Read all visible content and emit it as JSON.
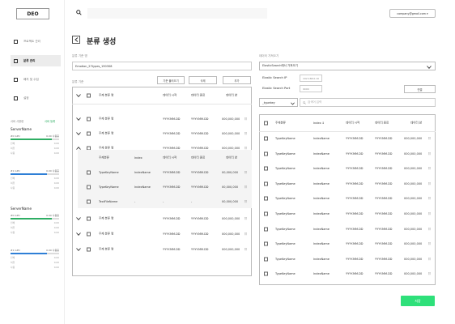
{
  "logo": "DEO",
  "nav": [
    {
      "label": "프로젝트 관리",
      "active": false
    },
    {
      "label": "분류 관리",
      "active": true
    },
    {
      "label": "배치 및 수집",
      "active": false
    },
    {
      "label": "설정",
      "active": false
    }
  ],
  "server_section": {
    "label": "서버 사용량",
    "link": "서버 등록"
  },
  "servers": [
    {
      "name": "ServerName",
      "metrics": [
        {
          "name": "#0 GPU",
          "value": "0.00 사용중",
          "fill": 0.85,
          "color": "#2fae64",
          "rows": [
            [
              "전체",
              "0.00"
            ],
            [
              "여유",
              "0.00"
            ],
            [
              "사용",
              "0.00"
            ]
          ]
        },
        {
          "name": "#1 GPU",
          "value": "0.00 사용중",
          "fill": 0.75,
          "color": "#2f7fd6",
          "rows": [
            [
              "전체",
              "0.00"
            ],
            [
              "여유",
              "0.00"
            ],
            [
              "사용",
              "0.00"
            ]
          ]
        }
      ]
    },
    {
      "name": "ServerName",
      "metrics": [
        {
          "name": "#0 GPU",
          "value": "0.00 사용중",
          "fill": 0.85,
          "color": "#2fae64",
          "rows": [
            [
              "전체",
              "0.00"
            ],
            [
              "여유",
              "0.00"
            ],
            [
              "사용",
              "0.00"
            ]
          ]
        },
        {
          "name": "#1 GPU",
          "value": "0.00 사용중",
          "fill": 0.75,
          "color": "#2f7fd6",
          "rows": [
            [
              "전체",
              "0.00"
            ],
            [
              "여유",
              "0.00"
            ],
            [
              "사용",
              "0.00"
            ]
          ]
        }
      ]
    }
  ],
  "header": {
    "account": "company@gmail.com ▾"
  },
  "page": {
    "title": "분류 생성"
  },
  "left": {
    "name_label": "분류 기준 명",
    "name_value": "Emotion_27types_190308",
    "criteria_label": "분류 기준",
    "buttons": [
      "기준 불러오기",
      "삭제",
      "추가"
    ],
    "columns": [
      "주제 분류 명",
      "데이터 시작",
      "데이터 종료",
      "데이터 양"
    ],
    "sub_columns": [
      "주제분류",
      "Index",
      "데이터 시작",
      "데이터 종료",
      "데이터 양"
    ],
    "rows": [
      {
        "label": "주제 분류 명",
        "start": "YYYY.MM.DD",
        "end": "YYYY.MM.DD",
        "amount": "000,000,000"
      },
      {
        "label": "주제 분류 명",
        "start": "YYYY.MM.DD",
        "end": "YYYY.MM.DD",
        "amount": "000,000,000"
      },
      {
        "label": "주제 분류 명",
        "start": "YYYY.MM.DD",
        "end": "YYYY.MM.DD",
        "amount": "000,000,000"
      }
    ],
    "sub_rows": [
      {
        "type": "TypeKeyName",
        "index": "IndexName",
        "start": "YYYY.MM.DD",
        "end": "YYYY.MM.DD",
        "amount": "00,000,000"
      },
      {
        "type": "TypeKeyName",
        "index": "IndexName",
        "start": "YYYY.MM.DD",
        "end": "YYYY.MM.DD",
        "amount": "00,000,000"
      },
      {
        "type": "TextFileName",
        "index": "-",
        "start": "-",
        "end": "-",
        "amount": "00,000,000"
      }
    ],
    "rows_after": [
      {
        "label": "주제 분류 명",
        "start": "YYYY.MM.DD",
        "end": "YYYY.MM.DD",
        "amount": "000,000,000"
      },
      {
        "label": "주제 분류 명",
        "start": "YYYY.MM.DD",
        "end": "YYYY.MM.DD",
        "amount": "000,000,000"
      },
      {
        "label": "주제 분류 명",
        "start": "YYYY.MM.DD",
        "end": "YYYY.MM.DD",
        "amount": "000,000,000"
      }
    ]
  },
  "right": {
    "section_label": "데이터 가져오기",
    "source_select": "ElasticSearch에서 가져오기",
    "es_ip_label": "Elastic Search IP",
    "es_ip_value": "192.168.0.10",
    "es_port_label": "Elastic Search Port",
    "es_port_value": "9000",
    "connect_button": "연결",
    "type_select": "_typekey",
    "search_placeholder": "검색어 입력",
    "columns": [
      "주제분류",
      "Index ↕",
      "데이터 시작",
      "데이터 종료",
      "데이터 양"
    ],
    "rows": [
      {
        "type": "TypeKeyName",
        "index": "IndexName",
        "start": "YYYY.MM.DD",
        "end": "YYYY.MM.DD",
        "amount": "000,000,000"
      },
      {
        "type": "TypeKeyName",
        "index": "IndexName",
        "start": "YYYY.MM.DD",
        "end": "YYYY.MM.DD",
        "amount": "000,000,000"
      },
      {
        "type": "TypeKeyName",
        "index": "IndexName",
        "start": "YYYY.MM.DD",
        "end": "YYYY.MM.DD",
        "amount": "000,000,000"
      },
      {
        "type": "TypeKeyName",
        "index": "IndexName",
        "start": "YYYY.MM.DD",
        "end": "YYYY.MM.DD",
        "amount": "000,000,000"
      },
      {
        "type": "TypeKeyName",
        "index": "IndexName",
        "start": "YYYY.MM.DD",
        "end": "YYYY.MM.DD",
        "amount": "000,000,000"
      },
      {
        "type": "TypeKeyName",
        "index": "IndexName",
        "start": "YYYY.MM.DD",
        "end": "YYYY.MM.DD",
        "amount": "000,000,000"
      },
      {
        "type": "TypeKeyName",
        "index": "IndexName",
        "start": "YYYY.MM.DD",
        "end": "YYYY.MM.DD",
        "amount": "000,000,000"
      },
      {
        "type": "TypeKeyName",
        "index": "IndexName",
        "start": "YYYY.MM.DD",
        "end": "YYYY.MM.DD",
        "amount": "000,000,000"
      },
      {
        "type": "TypeKeyName",
        "index": "IndexName",
        "start": "YYYY.MM.DD",
        "end": "YYYY.MM.DD",
        "amount": "000,000,000"
      },
      {
        "type": "TypeKeyName",
        "index": "IndexName",
        "start": "YYYY.MM.DD",
        "end": "YYYY.MM.DD",
        "amount": "000,000,000"
      }
    ]
  },
  "save_button": "저장",
  "colors": {
    "accent": "#2ee07a",
    "gpu_green": "#2fae64",
    "gpu_blue": "#2f7fd6"
  }
}
